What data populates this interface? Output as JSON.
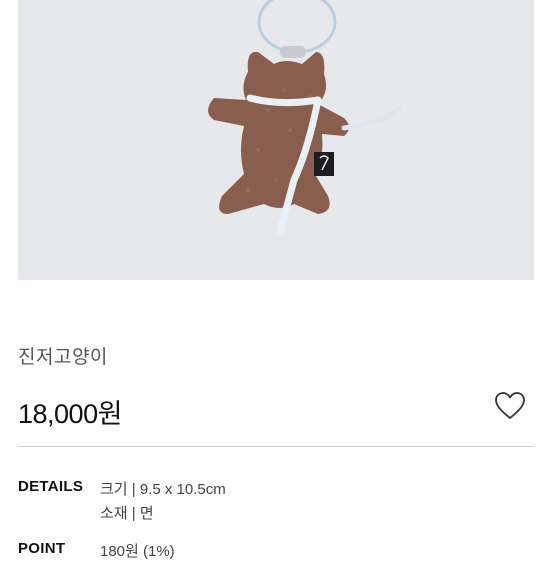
{
  "product": {
    "image_alt": "brown knitted cat keychain with white scarf",
    "title": "진저고양이",
    "price": "18,000원",
    "wishlist_icon": "heart-outline-icon"
  },
  "details": {
    "label": "DETAILS",
    "size": "크기 | 9.5 x 10.5cm",
    "material": "소재 | 면"
  },
  "point": {
    "label": "POINT",
    "value": "180원 (1%)"
  },
  "colors": {
    "photo_bg": "#e7e8ec",
    "plush": "#8a5e4e",
    "scarf": "#e9f1f8"
  }
}
